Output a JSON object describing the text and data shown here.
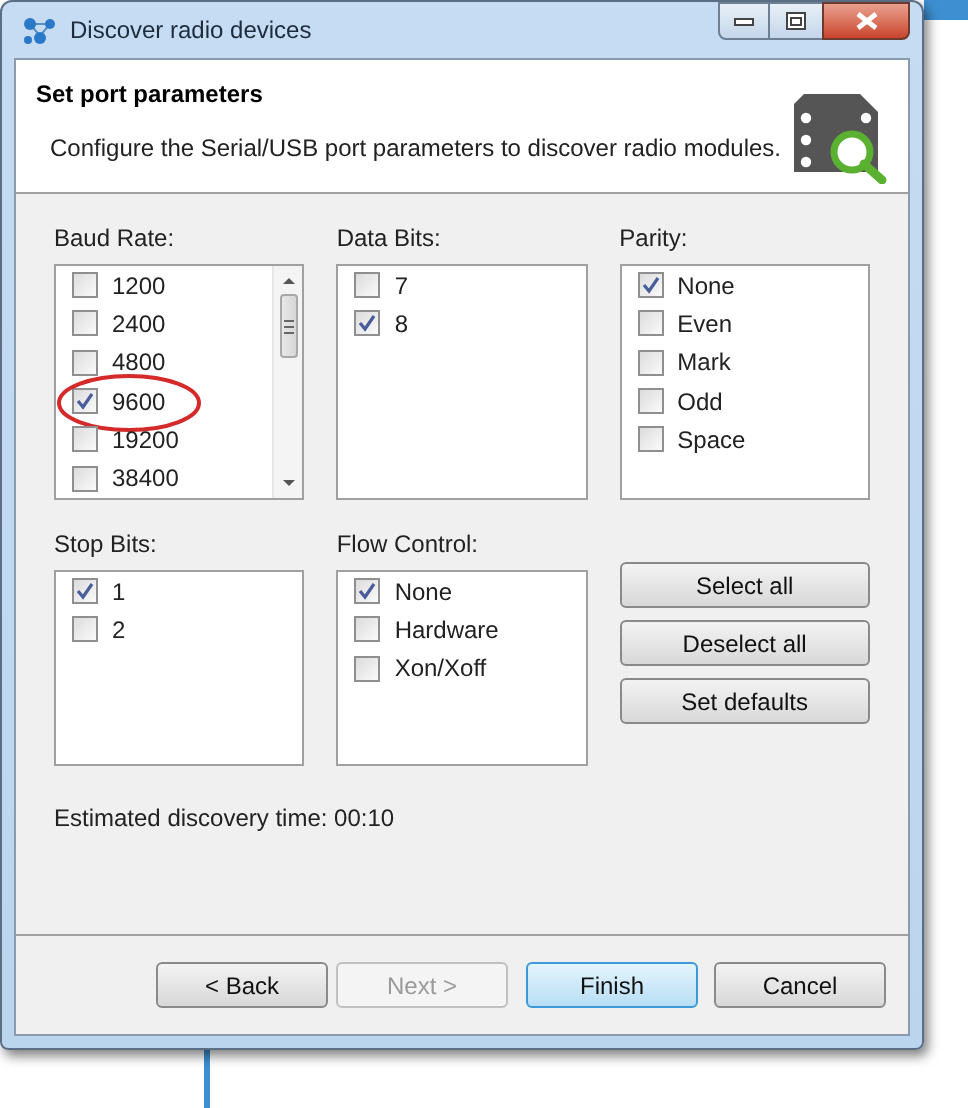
{
  "window": {
    "title": "Discover radio devices"
  },
  "header": {
    "title": "Set port parameters",
    "description": "Configure the Serial/USB port parameters to discover radio modules."
  },
  "groups": [
    {
      "label": "Baud Rate:",
      "scrollable": true,
      "items": [
        {
          "label": "1200",
          "checked": false
        },
        {
          "label": "2400",
          "checked": false
        },
        {
          "label": "4800",
          "checked": false
        },
        {
          "label": "9600",
          "checked": true,
          "circled": true
        },
        {
          "label": "19200",
          "checked": false
        },
        {
          "label": "38400",
          "checked": false
        }
      ]
    },
    {
      "label": "Data Bits:",
      "scrollable": false,
      "items": [
        {
          "label": "7",
          "checked": false
        },
        {
          "label": "8",
          "checked": true
        }
      ]
    },
    {
      "label": "Parity:",
      "scrollable": false,
      "items": [
        {
          "label": "None",
          "checked": true
        },
        {
          "label": "Even",
          "checked": false
        },
        {
          "label": "Mark",
          "checked": false
        },
        {
          "label": "Odd",
          "checked": false
        },
        {
          "label": "Space",
          "checked": false
        }
      ]
    },
    {
      "label": "Stop Bits:",
      "scrollable": false,
      "items": [
        {
          "label": "1",
          "checked": true
        },
        {
          "label": "2",
          "checked": false
        }
      ]
    },
    {
      "label": "Flow Control:",
      "scrollable": false,
      "items": [
        {
          "label": "None",
          "checked": true
        },
        {
          "label": "Hardware",
          "checked": false
        },
        {
          "label": "Xon/Xoff",
          "checked": false
        }
      ]
    }
  ],
  "side_buttons": [
    "Select all",
    "Deselect all",
    "Set defaults"
  ],
  "estimate": "Estimated discovery time: 00:10",
  "footer_buttons": [
    {
      "label": "< Back",
      "disabled": false,
      "default": false
    },
    {
      "label": "Next >",
      "disabled": true,
      "default": false
    },
    {
      "label": "Finish",
      "disabled": false,
      "default": true
    },
    {
      "label": "Cancel",
      "disabled": false,
      "default": false
    }
  ]
}
